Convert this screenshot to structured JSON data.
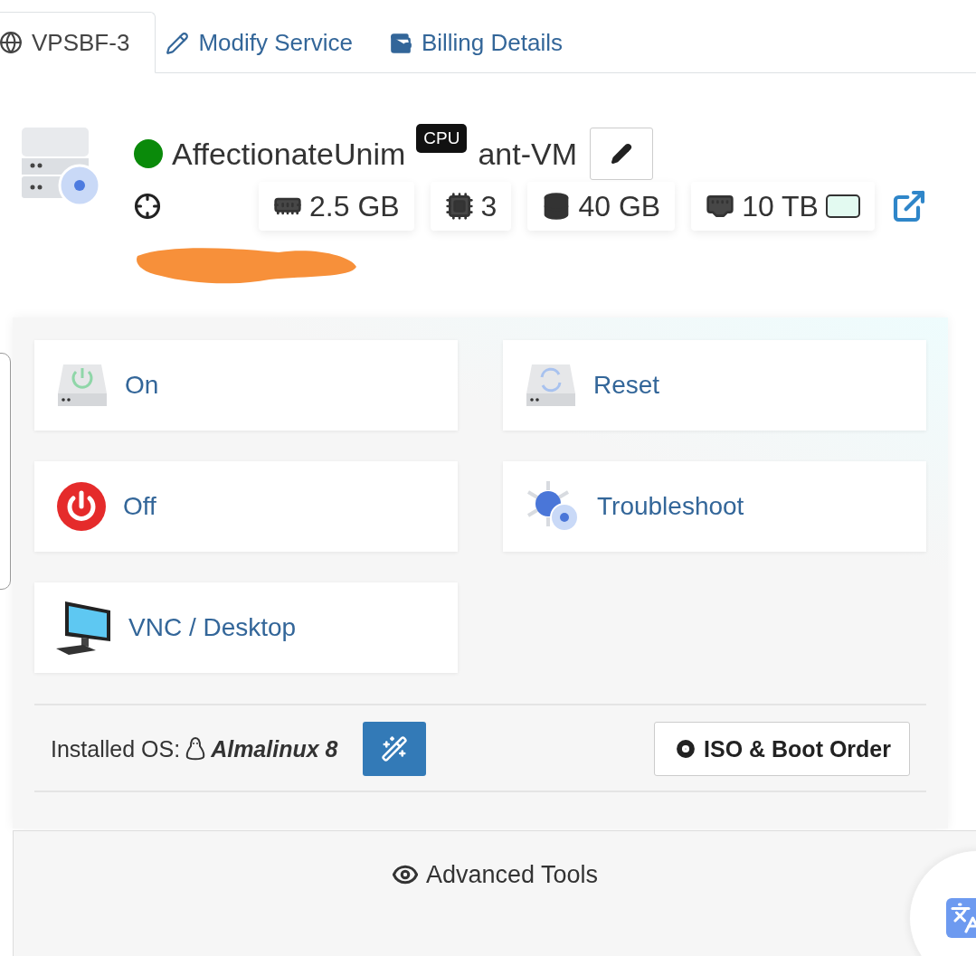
{
  "tabs": [
    {
      "label": "VPSBF-3",
      "selected": true
    },
    {
      "label": "Modify Service",
      "selected": false
    },
    {
      "label": "Billing Details",
      "selected": false
    }
  ],
  "server": {
    "name_parts": [
      "AffectionateUnim",
      "ant-VM"
    ],
    "color": "#0a8a0a",
    "tooltip": "CPU"
  },
  "specs": [
    {
      "kind": "ram",
      "value": "2.5 GB"
    },
    {
      "kind": "cpu",
      "value": "3"
    },
    {
      "kind": "disk",
      "value": "40 GB"
    },
    {
      "kind": "bandwidth",
      "value": "10 TB"
    }
  ],
  "actions": [
    {
      "kind": "on",
      "label": "On"
    },
    {
      "kind": "reset",
      "label": "Reset"
    },
    {
      "kind": "off",
      "label": "Off"
    },
    {
      "kind": "troubleshoot",
      "label": "Troubleshoot"
    },
    {
      "kind": "vnc",
      "label": "VNC / Desktop"
    }
  ],
  "os": {
    "label": "Installed OS:",
    "name": "Almalinux 8"
  },
  "iso_button": "ISO & Boot Order",
  "advanced": "Advanced Tools"
}
